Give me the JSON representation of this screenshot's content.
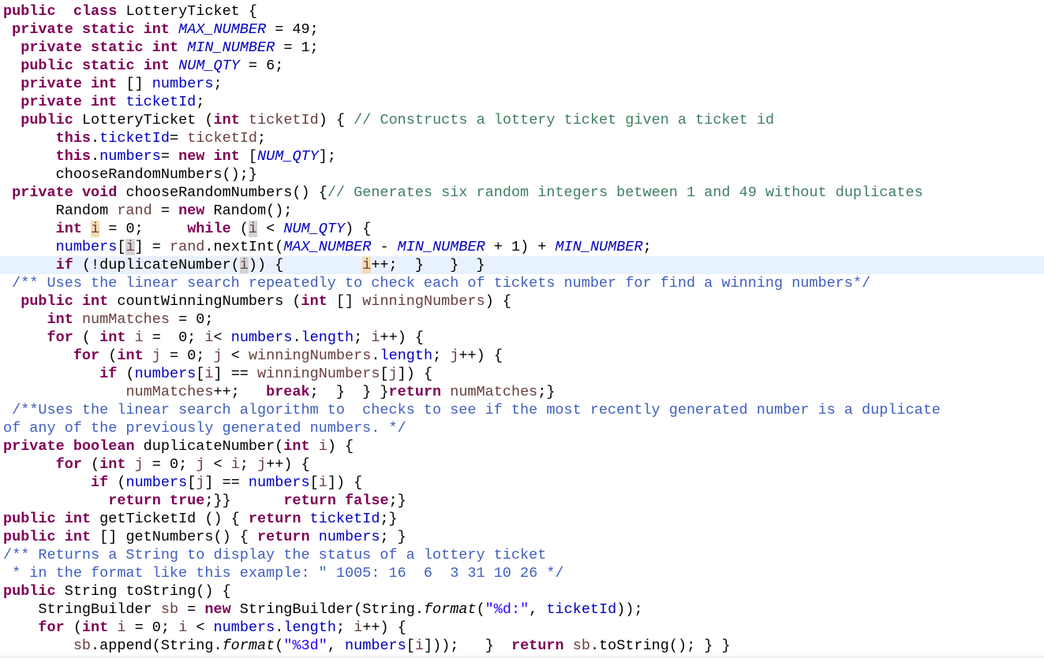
{
  "editor": {
    "language": "java",
    "current_line_index": 14,
    "colors": {
      "keyword": "#7f0055",
      "field": "#0000c0",
      "local_variable": "#6a3e3e",
      "line_comment": "#3f7f5f",
      "javadoc_comment": "#3f5fbf",
      "string": "#2a00ff",
      "current_line_bg": "#e8f2fe",
      "write_occurrence_bg": "#f4dcae",
      "read_occurrence_bg": "#d4d4d4"
    },
    "lines": [
      [
        [
          "kw",
          "public"
        ],
        [
          "",
          "  "
        ],
        [
          "kw",
          "class"
        ],
        [
          "",
          " LotteryTicket {"
        ]
      ],
      [
        [
          "",
          " "
        ],
        [
          "kw",
          "private"
        ],
        [
          "",
          " "
        ],
        [
          "kw",
          "static"
        ],
        [
          "",
          " "
        ],
        [
          "kw",
          "int"
        ],
        [
          "",
          " "
        ],
        [
          "sfld",
          "MAX_NUMBER"
        ],
        [
          "",
          " = 49;"
        ]
      ],
      [
        [
          "",
          "  "
        ],
        [
          "kw",
          "private"
        ],
        [
          "",
          " "
        ],
        [
          "kw",
          "static"
        ],
        [
          "",
          " "
        ],
        [
          "kw",
          "int"
        ],
        [
          "",
          " "
        ],
        [
          "sfld",
          "MIN_NUMBER"
        ],
        [
          "",
          " = 1;"
        ]
      ],
      [
        [
          "",
          "  "
        ],
        [
          "kw",
          "public"
        ],
        [
          "",
          " "
        ],
        [
          "kw",
          "static"
        ],
        [
          "",
          " "
        ],
        [
          "kw",
          "int"
        ],
        [
          "",
          " "
        ],
        [
          "sfld",
          "NUM_QTY"
        ],
        [
          "",
          " = 6;"
        ]
      ],
      [
        [
          "",
          "  "
        ],
        [
          "kw",
          "private"
        ],
        [
          "",
          " "
        ],
        [
          "kw",
          "int"
        ],
        [
          "",
          " [] "
        ],
        [
          "fld",
          "numbers"
        ],
        [
          "",
          ";"
        ]
      ],
      [
        [
          "",
          "  "
        ],
        [
          "kw",
          "private"
        ],
        [
          "",
          " "
        ],
        [
          "kw",
          "int"
        ],
        [
          "",
          " "
        ],
        [
          "fld",
          "ticketId"
        ],
        [
          "",
          ";"
        ]
      ],
      [
        [
          "",
          "  "
        ],
        [
          "kw",
          "public"
        ],
        [
          "",
          " LotteryTicket ("
        ],
        [
          "kw",
          "int"
        ],
        [
          "",
          " "
        ],
        [
          "var",
          "ticketId"
        ],
        [
          "",
          ") { "
        ],
        [
          "cmt",
          "// Constructs a lottery ticket given a ticket id"
        ]
      ],
      [
        [
          "",
          "      "
        ],
        [
          "kw",
          "this"
        ],
        [
          "",
          "."
        ],
        [
          "fld",
          "ticketId"
        ],
        [
          "",
          "= "
        ],
        [
          "var",
          "ticketId"
        ],
        [
          "",
          ";"
        ]
      ],
      [
        [
          "",
          "      "
        ],
        [
          "kw",
          "this"
        ],
        [
          "",
          "."
        ],
        [
          "fld",
          "numbers"
        ],
        [
          "",
          "= "
        ],
        [
          "kw",
          "new"
        ],
        [
          "",
          " "
        ],
        [
          "kw",
          "int"
        ],
        [
          "",
          " ["
        ],
        [
          "sfld",
          "NUM_QTY"
        ],
        [
          "",
          "];"
        ]
      ],
      [
        [
          "",
          "      chooseRandomNumbers();}"
        ]
      ],
      [
        [
          "",
          " "
        ],
        [
          "kw",
          "private"
        ],
        [
          "",
          " "
        ],
        [
          "kw",
          "void"
        ],
        [
          "",
          " chooseRandomNumbers() {"
        ],
        [
          "cmt",
          "// Generates six random integers between 1 and 49 without duplicates"
        ]
      ],
      [
        [
          "",
          "      Random "
        ],
        [
          "var",
          "rand"
        ],
        [
          "",
          " = "
        ],
        [
          "kw",
          "new"
        ],
        [
          "",
          " Random();"
        ]
      ],
      [
        [
          "",
          "      "
        ],
        [
          "kw",
          "int"
        ],
        [
          "",
          " "
        ],
        [
          "var occ-w",
          "i"
        ],
        [
          "",
          " = 0;     "
        ],
        [
          "kw",
          "while"
        ],
        [
          "",
          " ("
        ],
        [
          "var occ-r",
          "i"
        ],
        [
          "",
          " < "
        ],
        [
          "sfld",
          "NUM_QTY"
        ],
        [
          "",
          ") {"
        ]
      ],
      [
        [
          "",
          "      "
        ],
        [
          "fld",
          "numbers"
        ],
        [
          "",
          "["
        ],
        [
          "var occ-r",
          "i"
        ],
        [
          "",
          "] = "
        ],
        [
          "var",
          "rand"
        ],
        [
          "",
          ".nextInt("
        ],
        [
          "sfld",
          "MAX_NUMBER"
        ],
        [
          "",
          " - "
        ],
        [
          "sfld",
          "MIN_NUMBER"
        ],
        [
          "",
          " + 1) + "
        ],
        [
          "sfld",
          "MIN_NUMBER"
        ],
        [
          "",
          ";"
        ]
      ],
      [
        [
          "",
          "      "
        ],
        [
          "kw",
          "if"
        ],
        [
          "",
          " (!duplicateNumber("
        ],
        [
          "var occ-r",
          "i"
        ],
        [
          "",
          ")) {         "
        ],
        [
          "var occ-w",
          "i"
        ],
        [
          "",
          "++;  }   }  }"
        ]
      ],
      [
        [
          "",
          " "
        ],
        [
          "doc",
          "/** Uses the linear search repeatedly to check each of tickets number for find a winning numbers*/"
        ]
      ],
      [
        [
          "",
          "  "
        ],
        [
          "kw",
          "public"
        ],
        [
          "",
          " "
        ],
        [
          "kw",
          "int"
        ],
        [
          "",
          " countWinningNumbers ("
        ],
        [
          "kw",
          "int"
        ],
        [
          "",
          " [] "
        ],
        [
          "var",
          "winningNumbers"
        ],
        [
          "",
          ") {"
        ]
      ],
      [
        [
          "",
          "     "
        ],
        [
          "kw",
          "int"
        ],
        [
          "",
          " "
        ],
        [
          "var",
          "numMatches"
        ],
        [
          "",
          " = 0;"
        ]
      ],
      [
        [
          "",
          "     "
        ],
        [
          "kw",
          "for"
        ],
        [
          "",
          " ( "
        ],
        [
          "kw",
          "int"
        ],
        [
          "",
          " "
        ],
        [
          "var",
          "i"
        ],
        [
          "",
          " =  0; "
        ],
        [
          "var",
          "i"
        ],
        [
          "",
          "< "
        ],
        [
          "fld",
          "numbers"
        ],
        [
          "",
          "."
        ],
        [
          "fld",
          "length"
        ],
        [
          "",
          "; "
        ],
        [
          "var",
          "i"
        ],
        [
          "",
          "++) {"
        ]
      ],
      [
        [
          "",
          "        "
        ],
        [
          "kw",
          "for"
        ],
        [
          "",
          " ("
        ],
        [
          "kw",
          "int"
        ],
        [
          "",
          " "
        ],
        [
          "var",
          "j"
        ],
        [
          "",
          " = 0; "
        ],
        [
          "var",
          "j"
        ],
        [
          "",
          " < "
        ],
        [
          "var",
          "winningNumbers"
        ],
        [
          "",
          "."
        ],
        [
          "fld",
          "length"
        ],
        [
          "",
          "; "
        ],
        [
          "var",
          "j"
        ],
        [
          "",
          "++) {"
        ]
      ],
      [
        [
          "",
          "           "
        ],
        [
          "kw",
          "if"
        ],
        [
          "",
          " ("
        ],
        [
          "fld",
          "numbers"
        ],
        [
          "",
          "["
        ],
        [
          "var",
          "i"
        ],
        [
          "",
          "] == "
        ],
        [
          "var",
          "winningNumbers"
        ],
        [
          "",
          "["
        ],
        [
          "var",
          "j"
        ],
        [
          "",
          "]) {"
        ]
      ],
      [
        [
          "",
          "              "
        ],
        [
          "var",
          "numMatches"
        ],
        [
          "",
          "++;   "
        ],
        [
          "kw",
          "break"
        ],
        [
          "",
          ";  }  } }"
        ],
        [
          "kw",
          "return"
        ],
        [
          "",
          " "
        ],
        [
          "var",
          "numMatches"
        ],
        [
          "",
          ";}"
        ]
      ],
      [
        [
          "",
          " "
        ],
        [
          "doc",
          "/**Uses the linear search algorithm to  checks to see if the most recently generated number is a duplicate"
        ]
      ],
      [
        [
          "doc",
          "of any of the previously generated numbers. */"
        ]
      ],
      [
        [
          "kw",
          "private"
        ],
        [
          "",
          " "
        ],
        [
          "kw",
          "boolean"
        ],
        [
          "",
          " duplicateNumber("
        ],
        [
          "kw",
          "int"
        ],
        [
          "",
          " "
        ],
        [
          "var",
          "i"
        ],
        [
          "",
          ") {"
        ]
      ],
      [
        [
          "",
          "      "
        ],
        [
          "kw",
          "for"
        ],
        [
          "",
          " ("
        ],
        [
          "kw",
          "int"
        ],
        [
          "",
          " "
        ],
        [
          "var",
          "j"
        ],
        [
          "",
          " = 0; "
        ],
        [
          "var",
          "j"
        ],
        [
          "",
          " < "
        ],
        [
          "var",
          "i"
        ],
        [
          "",
          "; "
        ],
        [
          "var",
          "j"
        ],
        [
          "",
          "++) {"
        ]
      ],
      [
        [
          "",
          "          "
        ],
        [
          "kw",
          "if"
        ],
        [
          "",
          " ("
        ],
        [
          "fld",
          "numbers"
        ],
        [
          "",
          "["
        ],
        [
          "var",
          "j"
        ],
        [
          "",
          "] == "
        ],
        [
          "fld",
          "numbers"
        ],
        [
          "",
          "["
        ],
        [
          "var",
          "i"
        ],
        [
          "",
          "]) {"
        ]
      ],
      [
        [
          "",
          "            "
        ],
        [
          "kw",
          "return"
        ],
        [
          "",
          " "
        ],
        [
          "kw",
          "true"
        ],
        [
          "",
          ";}}      "
        ],
        [
          "kw",
          "return"
        ],
        [
          "",
          " "
        ],
        [
          "kw",
          "false"
        ],
        [
          "",
          ";}"
        ]
      ],
      [
        [
          "kw",
          "public"
        ],
        [
          "",
          " "
        ],
        [
          "kw",
          "int"
        ],
        [
          "",
          " getTicketId () { "
        ],
        [
          "kw",
          "return"
        ],
        [
          "",
          " "
        ],
        [
          "fld",
          "ticketId"
        ],
        [
          "",
          ";}"
        ]
      ],
      [
        [
          "kw",
          "public"
        ],
        [
          "",
          " "
        ],
        [
          "kw",
          "int"
        ],
        [
          "",
          " [] getNumbers() { "
        ],
        [
          "kw",
          "return"
        ],
        [
          "",
          " "
        ],
        [
          "fld",
          "numbers"
        ],
        [
          "",
          "; }"
        ]
      ],
      [
        [
          "doc",
          "/** Returns a String to display the status of a lottery ticket"
        ]
      ],
      [
        [
          "doc",
          " * in the format like this example: \" 1005: 16  6  3 31 10 26 */"
        ]
      ],
      [
        [
          "kw",
          "public"
        ],
        [
          "",
          " String toString() {"
        ]
      ],
      [
        [
          "",
          "    StringBuilder "
        ],
        [
          "var",
          "sb"
        ],
        [
          "",
          " = "
        ],
        [
          "kw",
          "new"
        ],
        [
          "",
          " StringBuilder(String."
        ],
        [
          "smeth",
          "format"
        ],
        [
          "",
          "("
        ],
        [
          "str",
          "\"%d:\""
        ],
        [
          "",
          ", "
        ],
        [
          "fld",
          "ticketId"
        ],
        [
          "",
          "));"
        ]
      ],
      [
        [
          "",
          "    "
        ],
        [
          "kw",
          "for"
        ],
        [
          "",
          " ("
        ],
        [
          "kw",
          "int"
        ],
        [
          "",
          " "
        ],
        [
          "var",
          "i"
        ],
        [
          "",
          " = 0; "
        ],
        [
          "var",
          "i"
        ],
        [
          "",
          " < "
        ],
        [
          "fld",
          "numbers"
        ],
        [
          "",
          "."
        ],
        [
          "fld",
          "length"
        ],
        [
          "",
          "; "
        ],
        [
          "var",
          "i"
        ],
        [
          "",
          "++) {"
        ]
      ],
      [
        [
          "",
          "        "
        ],
        [
          "var",
          "sb"
        ],
        [
          "",
          ".append(String."
        ],
        [
          "smeth",
          "format"
        ],
        [
          "",
          "("
        ],
        [
          "str",
          "\"%3d\""
        ],
        [
          "",
          ", "
        ],
        [
          "fld",
          "numbers"
        ],
        [
          "",
          "["
        ],
        [
          "var",
          "i"
        ],
        [
          "",
          "]));   }  "
        ],
        [
          "kw",
          "return"
        ],
        [
          "",
          " "
        ],
        [
          "var",
          "sb"
        ],
        [
          "",
          ".toString(); } }"
        ]
      ]
    ]
  }
}
